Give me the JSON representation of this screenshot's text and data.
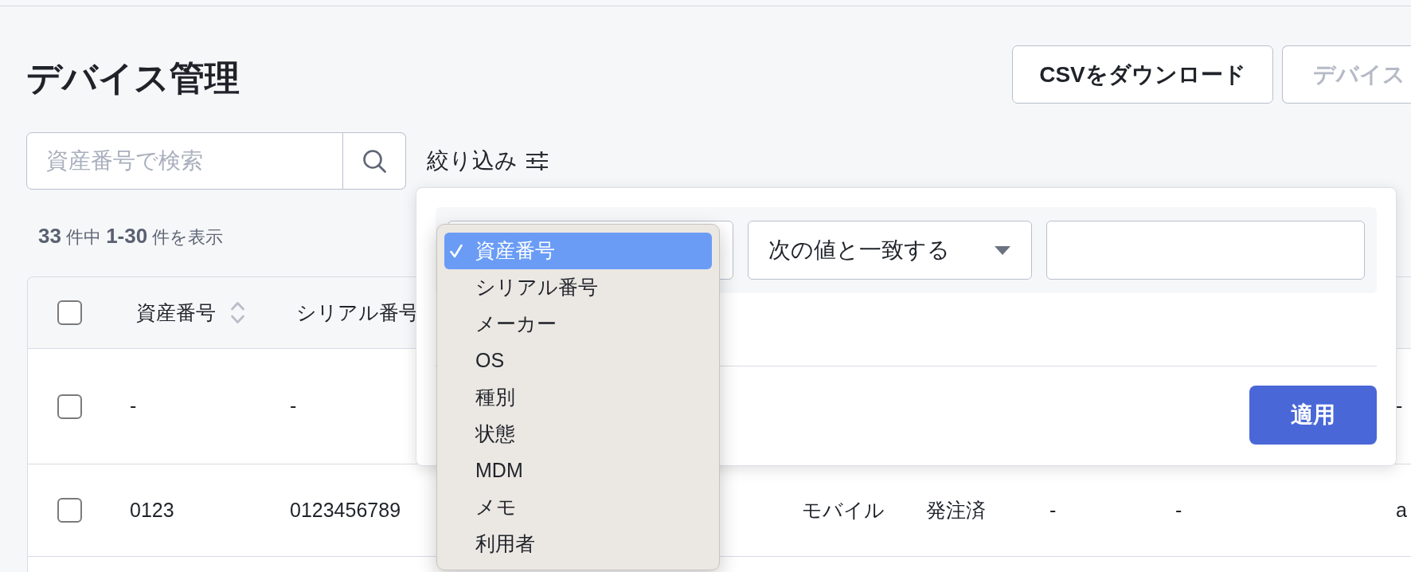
{
  "page_title": "デバイス管理",
  "header_buttons": [
    {
      "label": "CSVをダウンロード",
      "disabled": false
    },
    {
      "label": "デバイス",
      "disabled": true
    }
  ],
  "search": {
    "placeholder": "資産番号で検索"
  },
  "filter_toggle": {
    "label": "絞り込み"
  },
  "result_summary": "**33** 件中 **1-30** 件を表示",
  "table": {
    "select_all_checked": false,
    "columns": [
      {
        "label": "資産番号",
        "sortable": true
      },
      {
        "label": "シリアル番号",
        "sortable": false
      }
    ],
    "rows": [
      {
        "checked": false,
        "cells": {
          "column_1": "-",
          "column_2": "-",
          "column_9": "-"
        }
      },
      {
        "checked": false,
        "cells": {
          "column_1": "0123",
          "column_2": "0123456789",
          "column_5": "モバイル",
          "column_6": "発注済",
          "column_7": "-",
          "column_8": "-",
          "column_9": "a"
        }
      }
    ]
  },
  "filter_panel": {
    "conditions": [
      {
        "field_select": {
          "expanded": true,
          "options": [
            {
              "label": "資産番号",
              "selected": true
            },
            {
              "label": "シリアル番号",
              "selected": false
            },
            {
              "label": "メーカー",
              "selected": false
            },
            {
              "label": "OS",
              "selected": false
            },
            {
              "label": "種別",
              "selected": false
            },
            {
              "label": "状態",
              "selected": false
            },
            {
              "label": "MDM",
              "selected": false
            },
            {
              "label": "メモ",
              "selected": false
            },
            {
              "label": "利用者",
              "selected": false
            }
          ]
        },
        "operator_select": {
          "value": "次の値と一致する"
        }
      }
    ],
    "apply_button": {
      "label": "適用"
    }
  }
}
